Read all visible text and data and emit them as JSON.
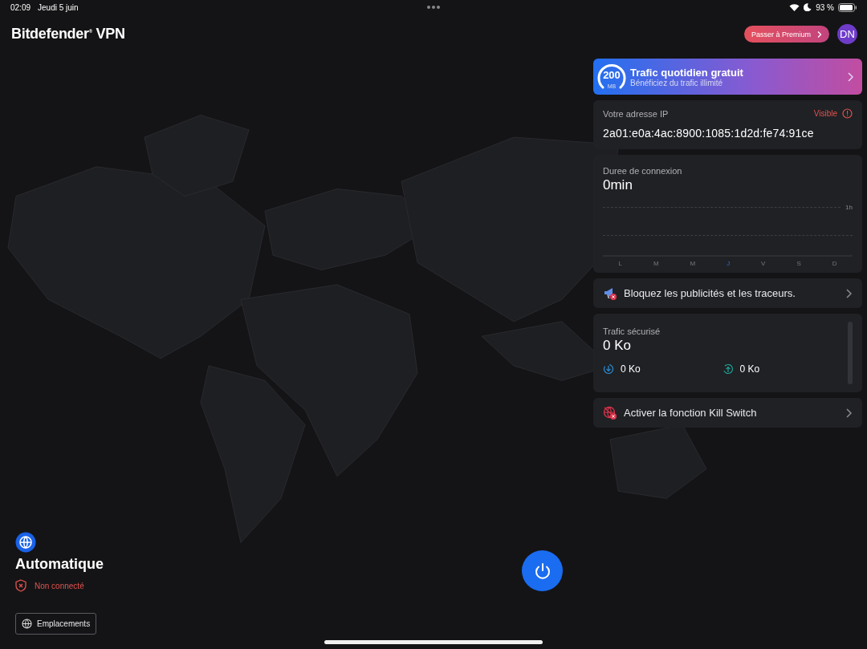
{
  "status_bar": {
    "time": "02:09",
    "date": "Jeudi 5 juin",
    "battery": "93 %"
  },
  "header": {
    "logo": "Bitdefender$^{®}$ VPN",
    "premium_button": "Passer à Premium",
    "avatar": "DN"
  },
  "promo": {
    "gauge_value": "200",
    "gauge_unit": "MB",
    "title": "Trafic quotidien gratuit",
    "subtitle": "Bénéficiez du trafic illimité"
  },
  "ip_card": {
    "label": "Votre adresse IP",
    "status": "Visible",
    "address": "2a01:e0a:4ac:8900:1085:1d2d:fe74:91ce"
  },
  "duration_card": {
    "label": "Duree de connexion",
    "value": "0min",
    "scale_label": "1h",
    "days": [
      {
        "label": "L",
        "selected": false
      },
      {
        "label": "M",
        "selected": false
      },
      {
        "label": "M",
        "selected": false
      },
      {
        "label": "J",
        "selected": true
      },
      {
        "label": "V",
        "selected": false
      },
      {
        "label": "S",
        "selected": false
      },
      {
        "label": "D",
        "selected": false
      }
    ]
  },
  "adblock_row": {
    "text": "Bloquez les publicités et les traceurs."
  },
  "traffic_card": {
    "label": "Trafic sécurisé",
    "total": "0 Ko",
    "download": "0 Ko",
    "upload": "0 Ko"
  },
  "killswitch_row": {
    "text": "Activer la fonction Kill Switch"
  },
  "location": {
    "name": "Automatique",
    "status": "Non connecté",
    "locations_button": "Emplacements"
  }
}
